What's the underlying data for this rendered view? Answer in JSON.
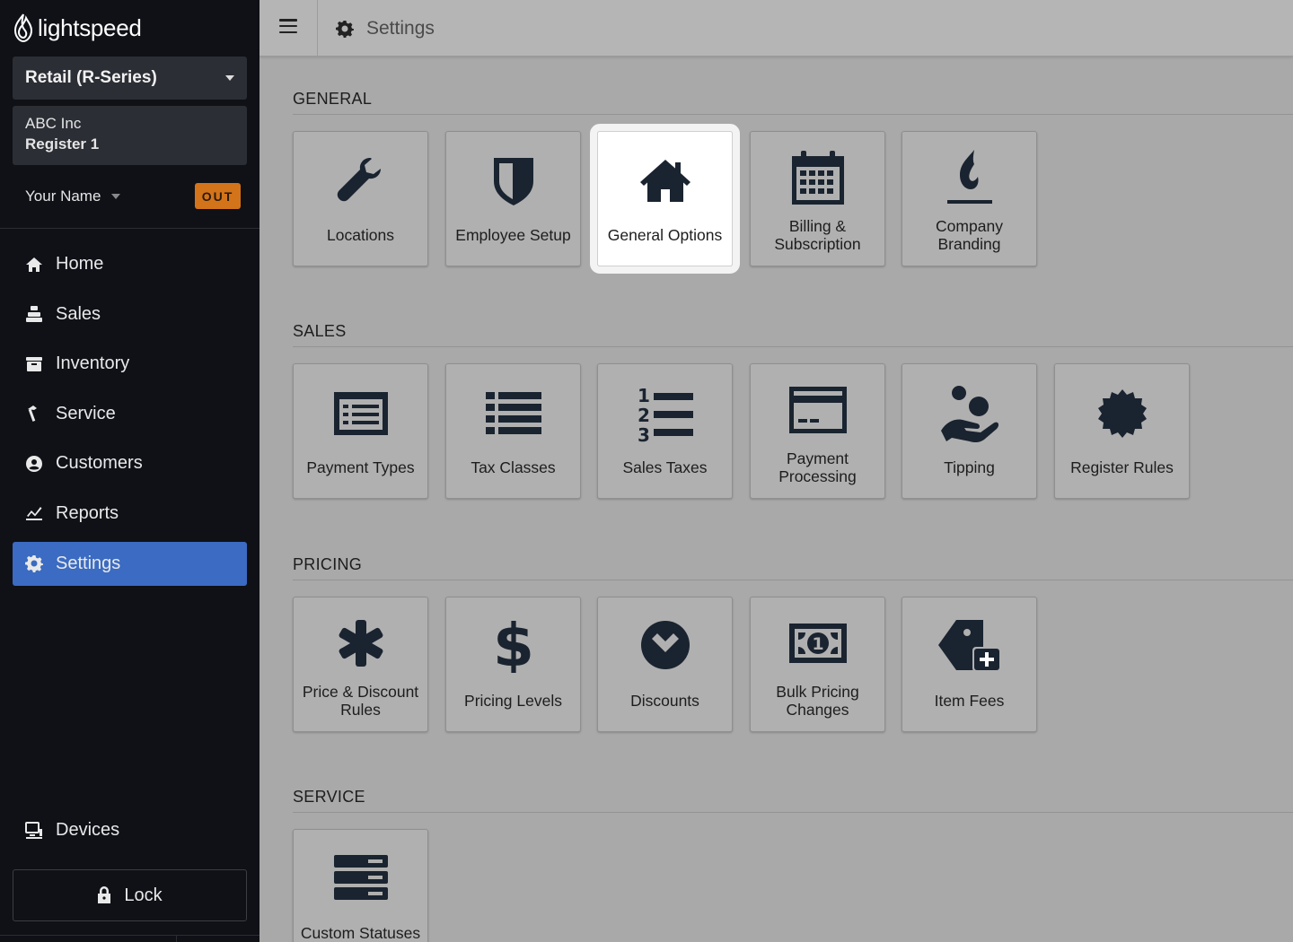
{
  "brand": {
    "logo_text": "lightspeed"
  },
  "sidebar": {
    "product": "Retail (R-Series)",
    "company": "ABC Inc",
    "register": "Register 1",
    "user_name": "Your Name",
    "out_badge": "OUT",
    "nav": [
      {
        "label": "Home",
        "icon": "home-icon"
      },
      {
        "label": "Sales",
        "icon": "register-icon"
      },
      {
        "label": "Inventory",
        "icon": "inventory-icon"
      },
      {
        "label": "Service",
        "icon": "hammer-icon"
      },
      {
        "label": "Customers",
        "icon": "user-circle-icon"
      },
      {
        "label": "Reports",
        "icon": "chart-icon"
      },
      {
        "label": "Settings",
        "icon": "gear-icon",
        "active": true
      }
    ],
    "devices": "Devices",
    "lock": "Lock"
  },
  "header": {
    "title": "Settings"
  },
  "sections": {
    "general": {
      "title": "GENERAL",
      "tiles": [
        "Locations",
        "Employee Setup",
        "General Options",
        "Billing & Subscription",
        "Company Branding"
      ]
    },
    "sales": {
      "title": "SALES",
      "tiles": [
        "Payment Types",
        "Tax Classes",
        "Sales Taxes",
        "Payment Processing",
        "Tipping",
        "Register Rules"
      ]
    },
    "pricing": {
      "title": "PRICING",
      "tiles": [
        "Price & Discount Rules",
        "Pricing Levels",
        "Discounts",
        "Bulk Pricing Changes",
        "Item Fees"
      ]
    },
    "service": {
      "title": "SERVICE",
      "tiles": [
        "Custom Statuses"
      ]
    }
  },
  "colors": {
    "accent": "#3b6bc2",
    "sidebar_bg": "#0f1117",
    "out_badge": "#d3741b",
    "icon": "#1a2430"
  }
}
